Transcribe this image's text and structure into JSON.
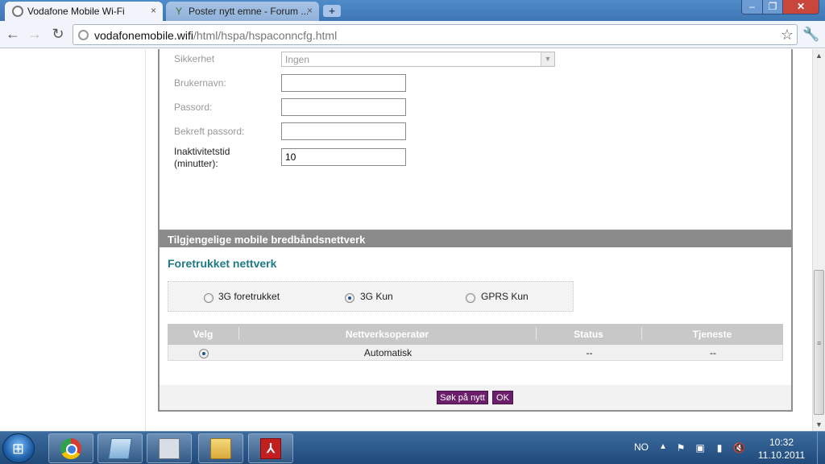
{
  "browser": {
    "tabs": [
      {
        "title": "Vodafone Mobile Wi-Fi",
        "close": "×"
      },
      {
        "title": "Poster nytt emne - Forum ...",
        "close": "×"
      }
    ],
    "new_tab": "+",
    "window_buttons": {
      "minimize": "–",
      "maximize": "❐",
      "close": "✕"
    },
    "nav": {
      "back": "←",
      "forward": "→",
      "reload": "↻"
    },
    "url_host": "vodafonemobile.wifi",
    "url_path": "/html/hspa/hspaconncfg.html",
    "star": "☆",
    "wrench": "🔧"
  },
  "settings_form": {
    "security": {
      "label": "Sikkerhet",
      "value": "Ingen",
      "arrow": "▼"
    },
    "username": {
      "label": "Brukernavn:",
      "value": ""
    },
    "password": {
      "label": "Passord:",
      "value": ""
    },
    "confirm_password": {
      "label": "Bekreft passord:",
      "value": ""
    },
    "inactivity": {
      "label_line1": "Inaktivitetstid",
      "label_line2": "(minutter):",
      "value": "10"
    },
    "ok_button": "OK"
  },
  "networks_panel": {
    "header": "Tilgjengelige mobile bredbåndsnettverk",
    "subtitle": "Foretrukket nettverk",
    "options": [
      {
        "label": "3G foretrukket",
        "selected": false
      },
      {
        "label": "3G Kun",
        "selected": true
      },
      {
        "label": "GPRS Kun",
        "selected": false
      }
    ],
    "table": {
      "columns": [
        "Velg",
        "Nettverksoperatør",
        "Status",
        "Tjeneste"
      ],
      "rows": [
        {
          "selected": true,
          "operator": "Automatisk",
          "status": "--",
          "service": "--"
        }
      ]
    },
    "search_again_button": "Søk på nytt",
    "ok_button": "OK"
  },
  "scrollbar": {
    "up": "▲",
    "down": "▼",
    "grip": "≡"
  },
  "taskbar": {
    "start_glyph": "⊞",
    "pdf_glyph": "⅄",
    "language": "NO",
    "tray_arrow": "▲",
    "tray_icons": [
      "⚑",
      "▣",
      "▮",
      "🔇"
    ],
    "time": "10:32",
    "date": "11.10.2011"
  },
  "colors": {
    "accent": "#6b1f6b",
    "subtitle": "#1e7a86",
    "panel_header": "#8a8a8a"
  }
}
